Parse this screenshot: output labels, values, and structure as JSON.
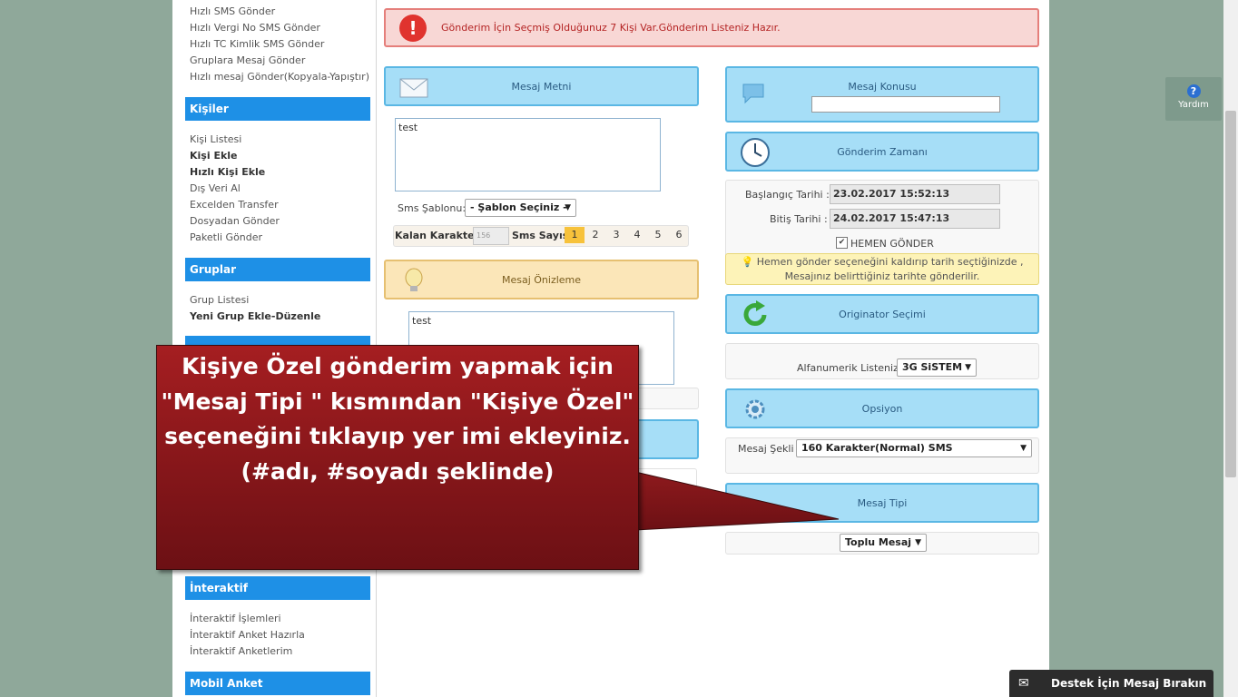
{
  "sidebar": {
    "sms_links": [
      "Hızlı SMS Gönder",
      "Hızlı Vergi No SMS Gönder",
      "Hızlı TC Kimlik SMS Gönder",
      "Gruplara Mesaj Gönder",
      "Hızlı mesaj Gönder(Kopyala-Yapıştır)"
    ],
    "kisiler_title": "Kişiler",
    "kisiler_links": [
      "Kişi Listesi",
      "Kişi Ekle",
      "Hızlı Kişi Ekle",
      "Dış Veri Al",
      "Excelden Transfer",
      "Dosyadan Gönder",
      "Paketli Gönder"
    ],
    "gruplar_title": "Gruplar",
    "gruplar_links": [
      "Grup Listesi",
      "Yeni Grup Ekle-Düzenle"
    ],
    "interaktif_title": "İnteraktif",
    "interaktif_links": [
      "İnteraktif İşlemleri",
      "İnteraktif Anket Hazırla",
      "İnteraktif Anketlerim"
    ],
    "mobil_anket_title": "Mobil Anket"
  },
  "alert": {
    "text": "Gönderim İçin Seçmiş Olduğunuz 7 Kişi Var.Gönderim Listeniz Hazır."
  },
  "message": {
    "title": "Mesaj Metni",
    "body": "test",
    "template_label": "Sms Şablonu:",
    "template_select": "- Şablon Seçiniz -",
    "remaining_label": "Kalan Karakter",
    "remaining_value": "156",
    "sms_count_label": "Sms Sayısı",
    "sms_counts": [
      "1",
      "2",
      "3",
      "4",
      "5",
      "6"
    ],
    "sms_active": "1"
  },
  "preview": {
    "title": "Mesaj Önizleme",
    "body": "test"
  },
  "subject": {
    "title": "Mesaj Konusu",
    "value": ""
  },
  "schedule": {
    "title": "Gönderim Zamanı",
    "start_label": "Başlangıç Tarihi :",
    "start_value": "23.02.2017 15:52:13",
    "end_label": "Bitiş Tarihi :",
    "end_value": "24.02.2017 15:47:13",
    "send_now_label": "HEMEN GÖNDER",
    "send_now_checked": true,
    "hint_line1": "Hemen gönder seçeneğini kaldırıp tarih seçtiğinizde ,",
    "hint_line2": "Mesajınız belirttiğiniz tarihte gönderilir."
  },
  "originator": {
    "title": "Originator Seçimi",
    "label": "Alfanumerik Listeniz",
    "value": "3G SiSTEM"
  },
  "options": {
    "title": "Opsiyon",
    "label": "Mesaj Şekli :",
    "value": "160 Karakter(Normal) SMS"
  },
  "message_type": {
    "title": "Mesaj Tipi",
    "value": "Toplu Mesaj"
  },
  "callout": {
    "line1": "Kişiye Özel gönderim yapmak için",
    "line2": "\"Mesaj Tipi \" kısmından \"Kişiye Özel\"",
    "line3": "seçeneğini tıklayıp yer imi ekleyiniz.",
    "line4": "(#adı, #soyadı şeklinde)"
  },
  "help": {
    "label": "Yardım"
  },
  "support": {
    "label": "Destek İçin Mesaj Bırakın"
  },
  "colors": {
    "accent": "#1e90e6",
    "panel_blue": "#a6def7",
    "alert_red": "#f8d7d5",
    "callout_red": "#a51e21"
  }
}
